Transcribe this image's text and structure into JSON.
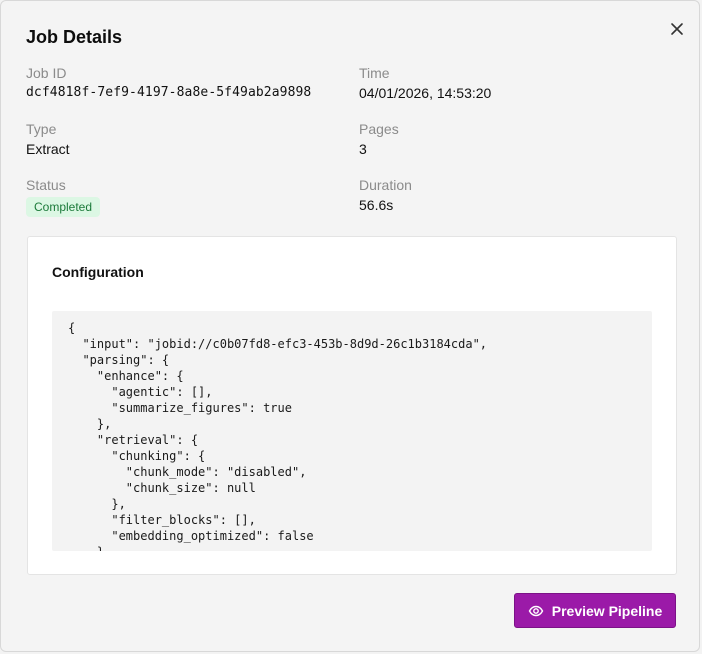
{
  "dialog": {
    "title": "Job Details"
  },
  "fields": {
    "job_id": {
      "label": "Job ID",
      "value": "dcf4818f-7ef9-4197-8a8e-5f49ab2a9898"
    },
    "time": {
      "label": "Time",
      "value": "04/01/2026, 14:53:20"
    },
    "type": {
      "label": "Type",
      "value": "Extract"
    },
    "pages": {
      "label": "Pages",
      "value": "3"
    },
    "status": {
      "label": "Status",
      "value": "Completed"
    },
    "duration": {
      "label": "Duration",
      "value": "56.6s"
    }
  },
  "configuration": {
    "title": "Configuration",
    "code": "{\n  \"input\": \"jobid://c0b07fd8-efc3-453b-8d9d-26c1b3184cda\",\n  \"parsing\": {\n    \"enhance\": {\n      \"agentic\": [],\n      \"summarize_figures\": true\n    },\n    \"retrieval\": {\n      \"chunking\": {\n        \"chunk_mode\": \"disabled\",\n        \"chunk_size\": null\n      },\n      \"filter_blocks\": [],\n      \"embedding_optimized\": false\n    }"
  },
  "actions": {
    "preview_label": "Preview Pipeline"
  },
  "icons": {
    "close": "close-icon",
    "preview": "eye-icon"
  },
  "colors": {
    "primary": "#9b1aa8",
    "status_bg": "#dcf7e4",
    "status_text": "#1c7a3a"
  }
}
